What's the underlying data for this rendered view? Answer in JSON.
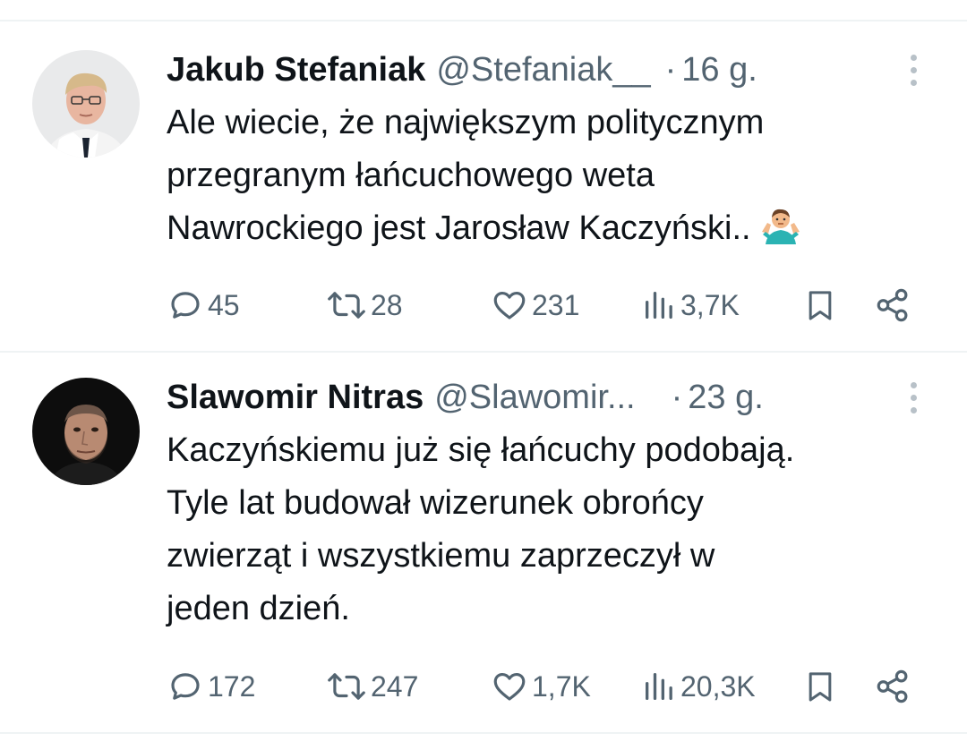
{
  "tweets": [
    {
      "author_name": "Jakub Stefaniak",
      "handle": "@Stefaniak__",
      "separator": "·",
      "time": "16 g.",
      "text_lines": [
        "Ale wiecie, że największym politycznym",
        "przegranym łańcuchowego weta",
        "Nawrockiego jest Jarosław Kaczyński.."
      ],
      "emoji": "person-shrugging",
      "replies": "45",
      "reposts": "28",
      "likes": "231",
      "views": "3,7K"
    },
    {
      "author_name": "Slawomir Nitras",
      "handle": "@Slawomir...",
      "separator": "·",
      "time": "23 g.",
      "text_lines": [
        "Kaczyńskiemu już się łańcuchy podobają.",
        "Tyle lat budował wizerunek obrońcy",
        "zwierząt i wszystkiemu zaprzeczył w",
        "jeden dzień."
      ],
      "replies": "172",
      "reposts": "247",
      "likes": "1,7K",
      "views": "20,3K"
    }
  ],
  "icons": {
    "reply": "reply-icon",
    "repost": "repost-icon",
    "like": "like-icon",
    "views": "views-icon",
    "bookmark": "bookmark-icon",
    "share": "share-icon",
    "more": "more-vertical-icon"
  },
  "colors": {
    "text": "#0f1419",
    "secondary": "#536471",
    "divider": "#eff3f4"
  }
}
